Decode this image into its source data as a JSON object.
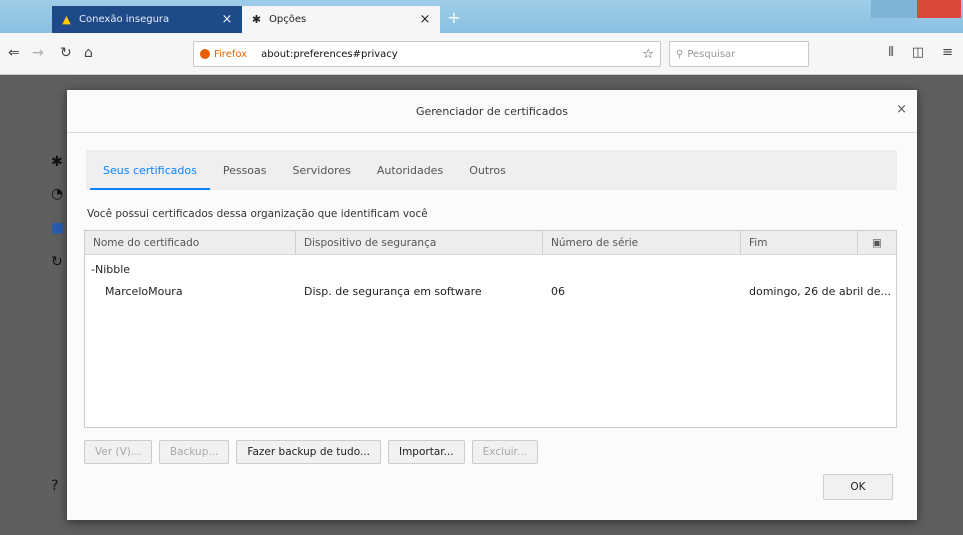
{
  "browser": {
    "tabs": [
      {
        "title": "Conexão insegura",
        "active": false
      },
      {
        "title": "Opções",
        "active": true
      }
    ],
    "url_brand": "Firefox",
    "url": "about:preferences#privacy",
    "search_placeholder": "Pesquisar"
  },
  "dialog": {
    "title": "Gerenciador de certificados",
    "tabs": [
      "Seus certificados",
      "Pessoas",
      "Servidores",
      "Autoridades",
      "Outros"
    ],
    "selected_tab": "Seus certificados",
    "description": "Você possui certificados dessa organização que identificam você",
    "columns": [
      "Nome do certificado",
      "Dispositivo de segurança",
      "Número de série",
      "Fim"
    ],
    "group": "-Nibble",
    "rows": [
      {
        "name": "MarceloMoura",
        "device": "Disp. de segurança em software",
        "serial": "06",
        "end": "domingo, 26 de abril de..."
      }
    ],
    "buttons": {
      "view": "Ver (V)...",
      "backup": "Backup...",
      "backup_all": "Fazer backup de tudo...",
      "import": "Importar...",
      "delete": "Excluir...",
      "ok": "OK"
    }
  },
  "colors": {
    "accent": "#0a84ff",
    "tab_inactive": "#1f4a8a",
    "titlebar": "#9ecde8"
  }
}
